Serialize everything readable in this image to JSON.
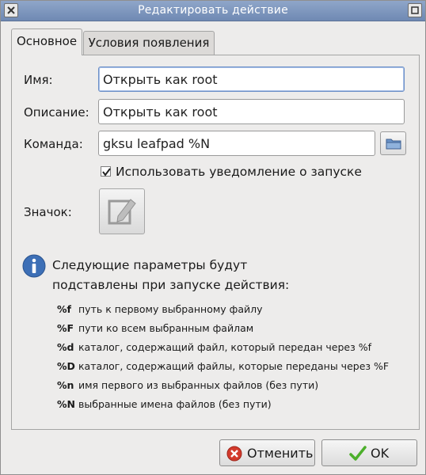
{
  "window": {
    "title": "Редактировать действие"
  },
  "tabs": [
    {
      "label": "Основное",
      "active": true
    },
    {
      "label": "Условия появления",
      "active": false
    }
  ],
  "fields": {
    "name": {
      "label": "Имя:",
      "value": "Открыть как root"
    },
    "description": {
      "label": "Описание:",
      "value": "Открыть как root"
    },
    "command": {
      "label": "Команда:",
      "value": "gksu leafpad %N"
    }
  },
  "startup_notify": {
    "label": "Использовать уведомление о запуске",
    "checked": true
  },
  "icon": {
    "label": "Значок:",
    "icon_name": "edit-pencil-icon"
  },
  "info": {
    "line1": "Следующие параметры будут",
    "line2": "подставлены при запуске действия:"
  },
  "params": [
    {
      "code": "%f",
      "desc": "путь к первому выбранному файлу"
    },
    {
      "code": "%F",
      "desc": "пути ко всем выбранным файлам"
    },
    {
      "code": "%d",
      "desc": "каталог, содержащий файл, который передан через %f"
    },
    {
      "code": "%D",
      "desc": "каталог, содержащий файлы, которые переданы через %F"
    },
    {
      "code": "%n",
      "desc": "имя первого из выбранных файлов (без пути)"
    },
    {
      "code": "%N",
      "desc": "выбранные имена файлов (без пути)"
    }
  ],
  "buttons": {
    "cancel": "Отменить",
    "ok": "OK"
  },
  "colors": {
    "titlebar": "#7f98bf",
    "info_blue": "#3d6fb6",
    "cancel_red": "#d33a2c",
    "ok_green": "#4caf2b"
  }
}
